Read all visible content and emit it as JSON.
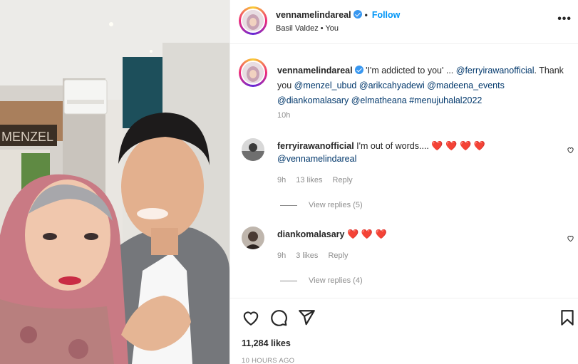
{
  "post": {
    "username": "vennamelindareal",
    "follow_label": "Follow",
    "dot": "•",
    "subtitle": "Basil Valdez • You",
    "more": "•••",
    "photo_sign": "MENZEL"
  },
  "caption": {
    "username": "vennamelindareal",
    "text_start": " 'I'm addicted to you' ... ",
    "mention1": "@ferryirawanofficial",
    "text_mid": ". Thank you ",
    "mention2": "@menzel_ubud",
    "mention3": "@arikcahyadewi",
    "mention4": "@madeena_events",
    "mention5": "@diankomalasary",
    "mention6": "@elmatheana",
    "hashtag": "#menujuhalal2022",
    "time": "10h"
  },
  "comments": [
    {
      "username": "ferryirawanofficial",
      "text": " I'm out of words.... ",
      "hearts": "❤️ ❤️ ❤️ ❤️",
      "mention": "@vennamelindareal",
      "time": "9h",
      "likes": "13 likes",
      "reply": "Reply",
      "view_replies": "View replies (5)"
    },
    {
      "username": "diankomalasary",
      "text": " ",
      "hearts": "❤️ ❤️ ❤️",
      "time": "9h",
      "likes": "3 likes",
      "reply": "Reply",
      "view_replies": "View replies (4)"
    }
  ],
  "actions": {
    "likes": "11,284 likes",
    "ago": "10 HOURS AGO",
    "icons": [
      "heart-icon",
      "comment-icon",
      "share-icon",
      "bookmark-icon"
    ]
  },
  "colors": {
    "accent": "#0095f6",
    "verified": "#3897f0",
    "heart": "#ed4956",
    "muted": "#8e8e8e"
  }
}
